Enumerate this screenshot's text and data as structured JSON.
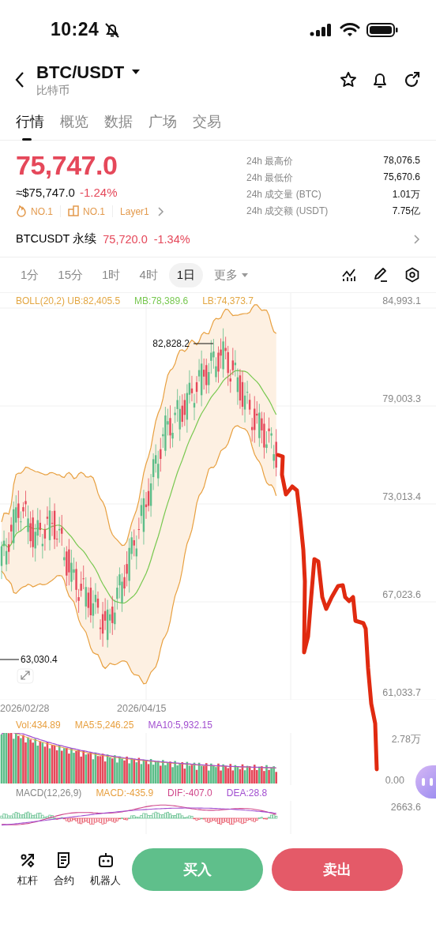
{
  "status_bar": {
    "time": "10:24"
  },
  "header": {
    "pair": "BTC/USDT",
    "subtitle": "比特币"
  },
  "tabs": [
    {
      "label": "行情",
      "selected": true
    },
    {
      "label": "概览",
      "selected": false
    },
    {
      "label": "数据",
      "selected": false
    },
    {
      "label": "广场",
      "selected": false
    },
    {
      "label": "交易",
      "selected": false
    }
  ],
  "price": {
    "last": "75,747.0",
    "fiat": "≈$75,747.0",
    "change": "-1.24%",
    "tags": [
      {
        "kind": "hot",
        "label": "NO.1"
      },
      {
        "kind": "rank",
        "label": "NO.1"
      },
      {
        "kind": "sector",
        "label": "Layer1"
      }
    ],
    "stats": [
      {
        "label": "24h 最高价",
        "value": "78,076.5"
      },
      {
        "label": "24h 最低价",
        "value": "75,670.6"
      },
      {
        "label": "24h 成交量 (BTC)",
        "value": "1.01万"
      },
      {
        "label": "24h 成交额 (USDT)",
        "value": "7.75亿"
      }
    ]
  },
  "perpetual": {
    "symbol": "BTCUSDT 永续",
    "price": "75,720.0",
    "change": "-1.34%"
  },
  "timeframes": [
    {
      "label": "1分",
      "selected": false
    },
    {
      "label": "15分",
      "selected": false
    },
    {
      "label": "1时",
      "selected": false
    },
    {
      "label": "4时",
      "selected": false
    },
    {
      "label": "1日",
      "selected": true
    },
    {
      "label": "更多",
      "selected": false
    }
  ],
  "chart": {
    "legend": [
      {
        "text": "BOLL(20,2) UB:82,405.5",
        "color": "#e3a743"
      },
      {
        "text": "MB:78,389.6",
        "color": "#78c850"
      },
      {
        "text": "LB:74,373.7",
        "color": "#e3a743"
      }
    ],
    "y_labels": [
      "84,993.1",
      "79,003.3",
      "73,013.4",
      "67,023.6",
      "61,033.7"
    ],
    "high_mark": "82,828.2",
    "low_mark": "63,030.4",
    "dates": [
      "2026/02/28",
      "2026/04/15"
    ]
  },
  "volume": {
    "legend": [
      {
        "text": "Vol:434.89",
        "color": "#e8a040"
      },
      {
        "text": "MA5:5,246.25",
        "color": "#e8a040"
      },
      {
        "text": "MA10:5,932.15",
        "color": "#a24fd0"
      }
    ],
    "y_labels": [
      "2.78万",
      "0.00"
    ]
  },
  "macd": {
    "legend": [
      {
        "text": "MACD(12,26,9)",
        "color": "#888888"
      },
      {
        "text": "MACD:-435.9",
        "color": "#e8a040"
      },
      {
        "text": "DIF:-407.0",
        "color": "#d0468a"
      },
      {
        "text": "DEA:28.8",
        "color": "#a24fd0"
      }
    ],
    "y_labels": [
      "2663.6"
    ]
  },
  "bottom_bar": {
    "tools": [
      {
        "kind": "leverage",
        "label": "杠杆"
      },
      {
        "kind": "contract",
        "label": "合约"
      },
      {
        "kind": "bot",
        "label": "机器人"
      }
    ],
    "buy": "买入",
    "sell": "卖出"
  }
}
